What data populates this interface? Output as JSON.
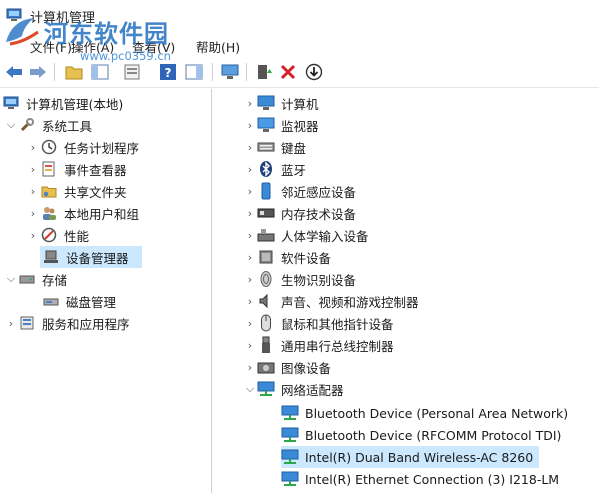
{
  "window": {
    "title": "计算机管理",
    "watermark": {
      "brand": "河东软件园",
      "url": "www.pc0359.cn"
    }
  },
  "menubar": {
    "items": [
      {
        "label": "文件(F)"
      },
      {
        "label": "操作(A)"
      },
      {
        "label": "查看(V)"
      },
      {
        "label": "帮助(H)"
      }
    ]
  },
  "left_tree": [
    {
      "label": "计算机管理(本地)",
      "icon": "computer-mgmt-icon"
    },
    {
      "label": "系统工具",
      "icon": "tools-icon",
      "expanded": true
    },
    {
      "label": "任务计划程序",
      "icon": "clock-icon"
    },
    {
      "label": "事件查看器",
      "icon": "event-viewer-icon"
    },
    {
      "label": "共享文件夹",
      "icon": "shared-folder-icon"
    },
    {
      "label": "本地用户和组",
      "icon": "users-icon"
    },
    {
      "label": "性能",
      "icon": "performance-icon"
    },
    {
      "label": "设备管理器",
      "icon": "device-manager-icon",
      "selected": true
    },
    {
      "label": "存储",
      "icon": "storage-icon",
      "expanded": true
    },
    {
      "label": "磁盘管理",
      "icon": "disk-mgmt-icon"
    },
    {
      "label": "服务和应用程序",
      "icon": "services-icon"
    }
  ],
  "device_tree": [
    {
      "label": "计算机",
      "icon": "computer-icon"
    },
    {
      "label": "监视器",
      "icon": "monitor-icon"
    },
    {
      "label": "键盘",
      "icon": "keyboard-icon"
    },
    {
      "label": "蓝牙",
      "icon": "bluetooth-icon"
    },
    {
      "label": "邻近感应设备",
      "icon": "proximity-icon"
    },
    {
      "label": "内存技术设备",
      "icon": "memory-icon"
    },
    {
      "label": "人体学输入设备",
      "icon": "hid-icon"
    },
    {
      "label": "软件设备",
      "icon": "software-device-icon"
    },
    {
      "label": "生物识别设备",
      "icon": "biometric-icon"
    },
    {
      "label": "声音、视频和游戏控制器",
      "icon": "speaker-icon"
    },
    {
      "label": "鼠标和其他指针设备",
      "icon": "mouse-icon"
    },
    {
      "label": "通用串行总线控制器",
      "icon": "usb-icon"
    },
    {
      "label": "图像设备",
      "icon": "camera-icon"
    },
    {
      "label": "网络适配器",
      "icon": "network-adapter-icon",
      "expanded": true
    },
    {
      "label": "Bluetooth Device (Personal Area Network)",
      "icon": "network-adapter-icon"
    },
    {
      "label": "Bluetooth Device (RFCOMM Protocol TDI)",
      "icon": "network-adapter-icon"
    },
    {
      "label": "Intel(R) Dual Band Wireless-AC 8260",
      "icon": "network-adapter-icon",
      "selected": true
    },
    {
      "label": "Intel(R) Ethernet Connection (3) I218-LM",
      "icon": "network-adapter-icon"
    }
  ],
  "colors": {
    "selection": "#cce8ff",
    "watermark": "#2f78c4"
  }
}
